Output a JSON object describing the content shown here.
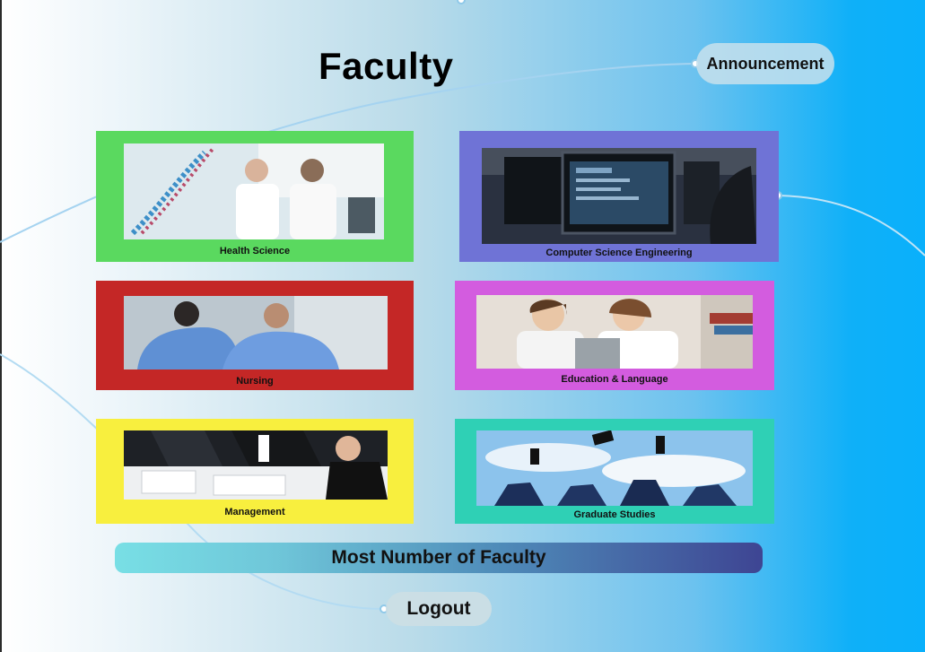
{
  "page": {
    "title": "Faculty"
  },
  "nav": {
    "announcement_label": "Announcement",
    "logout_label": "Logout"
  },
  "faculties": [
    {
      "label": "Health Science",
      "frame_color": "#5ad95f",
      "image": "lab-scientists-photo"
    },
    {
      "label": "Computer Science Engineering",
      "frame_color": "#6f73d6",
      "image": "computer-monitors-photo"
    },
    {
      "label": "Nursing",
      "frame_color": "#c42726",
      "image": "nurses-photo"
    },
    {
      "label": "Education & Language",
      "frame_color": "#d35cdf",
      "image": "students-reading-photo"
    },
    {
      "label": "Management",
      "frame_color": "#f8ef3e",
      "image": "business-meeting-photo"
    },
    {
      "label": "Graduate Studies",
      "frame_color": "#2fd0b5",
      "image": "graduation-caps-photo"
    }
  ],
  "stats": {
    "label": "Most Number of Faculty"
  }
}
